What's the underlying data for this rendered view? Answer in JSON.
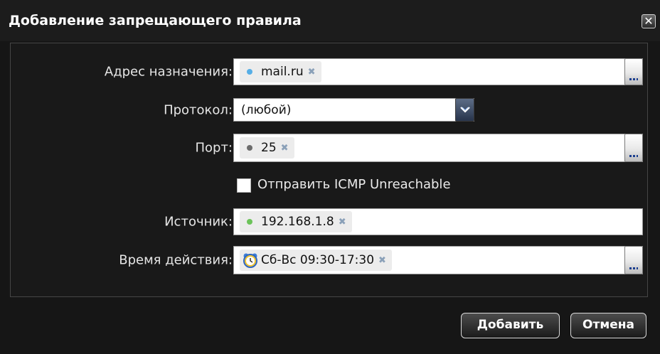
{
  "dialog": {
    "title": "Добавление запрещающего правила",
    "close_label": "✕"
  },
  "form": {
    "destination": {
      "label": "Адрес назначения:",
      "token": "mail.ru",
      "token_dot": "blue"
    },
    "protocol": {
      "label": "Протокол:",
      "value": "(любой)"
    },
    "port": {
      "label": "Порт:",
      "token": "25",
      "token_dot": "gray"
    },
    "icmp": {
      "label": "Отправить ICMP Unreachable",
      "checked": false
    },
    "source": {
      "label": "Источник:",
      "token": "192.168.1.8",
      "token_dot": "green"
    },
    "schedule": {
      "label": "Время действия:",
      "token": "Сб-Вс 09:30-17:30",
      "token_icon": "clock-icon"
    }
  },
  "token_remove": "✖",
  "buttons": {
    "add_label": "Добавить",
    "cancel_label": "Отмена"
  },
  "colors": {
    "background": "#161616",
    "panel_border": "#464646",
    "dot_blue": "#56aee6",
    "dot_gray": "#6c6c6c",
    "dot_green": "#6cc35a",
    "select_arrow": "#27344c"
  }
}
